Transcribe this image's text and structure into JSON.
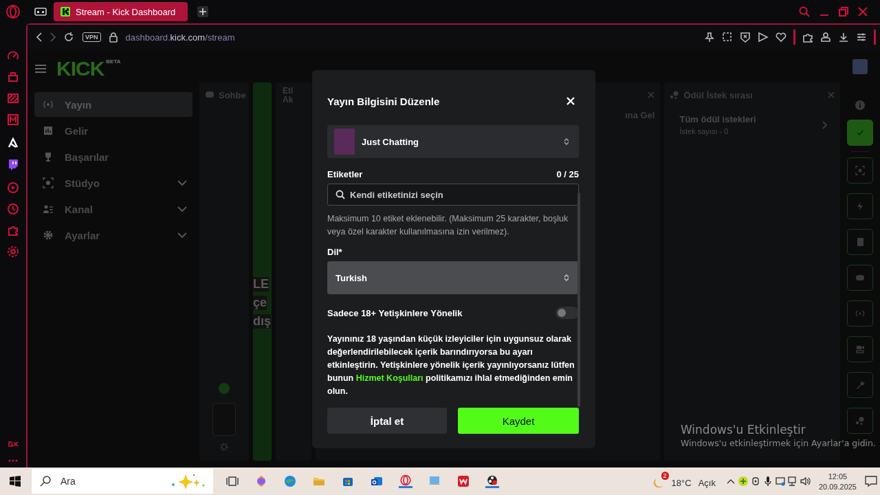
{
  "browser": {
    "tab_title": "Stream - Kick Dashboard",
    "vpn_badge": "VPN",
    "url_prefix": "dashboard.",
    "url_domain": "kick.com",
    "url_path": "/stream"
  },
  "dashboard": {
    "logo": "KICK",
    "logo_badge": "BETA",
    "nav": [
      {
        "label": "Yayın",
        "selected": true,
        "expandable": false
      },
      {
        "label": "Gelir",
        "selected": false,
        "expandable": false
      },
      {
        "label": "Başarılar",
        "selected": false,
        "expandable": false
      },
      {
        "label": "Stüdyo",
        "selected": false,
        "expandable": true
      },
      {
        "label": "Kanal",
        "selected": false,
        "expandable": true
      },
      {
        "label": "Ayarlar",
        "selected": false,
        "expandable": true
      }
    ],
    "panels": [
      {
        "kind": "chat",
        "title": "Sohbe"
      },
      {
        "kind": "strip",
        "lines": [
          "LE",
          "çe",
          "dış"
        ]
      },
      {
        "kind": "tags",
        "title": "Etl Ak"
      },
      {
        "kind": "hidden",
        "text": "ına Gel"
      },
      {
        "kind": "reward",
        "title": "Ödül İstek sırası",
        "item_title": "Tüm ödül istekleri",
        "item_subtitle": "İstek sayısı - 0"
      }
    ]
  },
  "modal": {
    "title": "Yayın Bilgisini Düzenle",
    "category": "Just Chatting",
    "tags_label": "Etiketler",
    "tags_count": "0 / 25",
    "tags_placeholder": "Kendi etiketinizi seçin",
    "tags_hint": "Maksimum 10 etiket eklenebilir. (Maksimum 25 karakter, boşluk veya özel karakter kullanılmasına izin verilmez).",
    "language_label": "Dil*",
    "language": "Turkish",
    "adult_label": "Sadece 18+ Yetişkinlere Yönelik",
    "adult_on": false,
    "adult_text_before": "Yayınınız 18 yaşından küçük izleyiciler için uygunsuz olarak değerlendirilebilecek içerik barındırıyorsa bu ayarı etkinleştirin. Yetişkinlere yönelik içerik yayınlıyorsanız lütfen bunun ",
    "adult_link": "Hizmet Koşulları",
    "adult_text_after": " politikamızı ihlal etmediğinden emin olun.",
    "cancel": "İptal et",
    "save": "Kaydet"
  },
  "activation": {
    "title": "Windows'u Etkinleştir",
    "subtitle": "Windows'u etkinleştirmek için Ayarlar'a gidin."
  },
  "taskbar": {
    "search_placeholder": "Ara",
    "weather_badge": "2",
    "temperature": "18°C",
    "condition": "Açık",
    "time": "12:05",
    "date": "20.09.2025"
  }
}
